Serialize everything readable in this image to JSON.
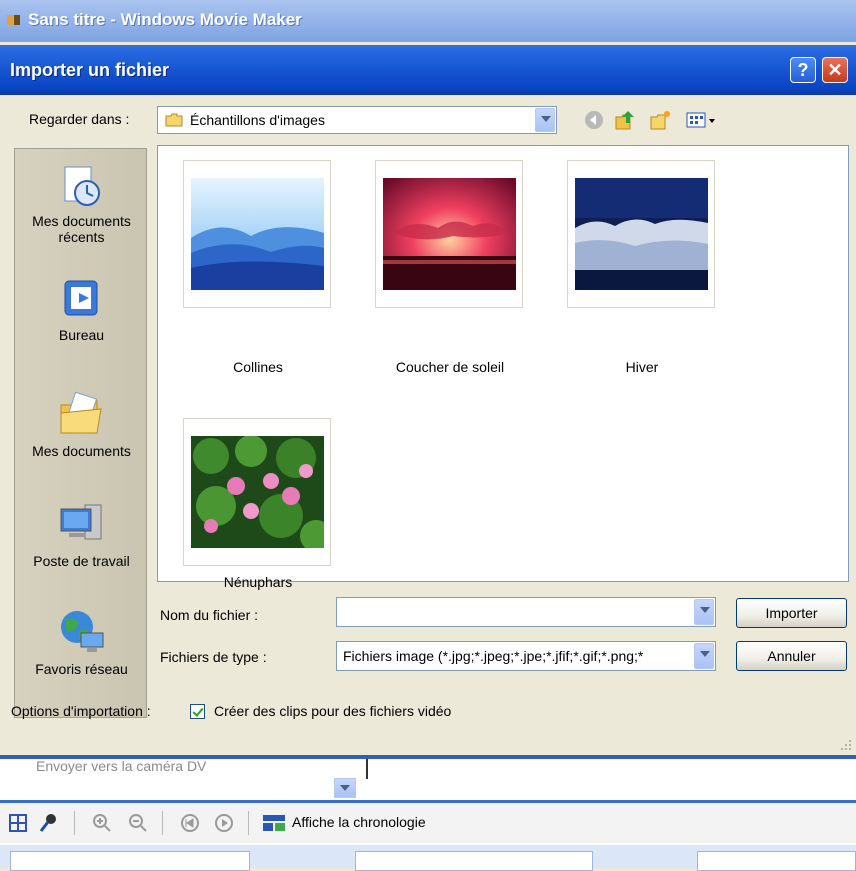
{
  "app": {
    "title": "Sans titre - Windows Movie Maker"
  },
  "dialog": {
    "title": "Importer un fichier",
    "help_glyph": "?",
    "close_glyph": "✕",
    "look_in": {
      "label": "Regarder dans :",
      "value": "Échantillons d'images"
    },
    "places": [
      {
        "label_line1": "Mes documents",
        "label_line2": "récents",
        "icon": "recent-documents-icon"
      },
      {
        "label_line1": "Bureau",
        "label_line2": "",
        "icon": "desktop-icon"
      },
      {
        "label_line1": "Mes documents",
        "label_line2": "",
        "icon": "my-documents-icon"
      },
      {
        "label_line1": "Poste de travail",
        "label_line2": "",
        "icon": "my-computer-icon"
      },
      {
        "label_line1": "Favoris réseau",
        "label_line2": "",
        "icon": "network-places-icon"
      }
    ],
    "files": [
      {
        "name": "Collines"
      },
      {
        "name": "Coucher de soleil"
      },
      {
        "name": "Hiver"
      },
      {
        "name": "Nénuphars"
      }
    ],
    "filename": {
      "label": "Nom du fichier :",
      "value": ""
    },
    "filetype": {
      "label": "Fichiers de type :",
      "value": "Fichiers image (*.jpg;*.jpeg;*.jpe;*.jfif;*.gif;*.png;*"
    },
    "import_button": "Importer",
    "cancel_button": "Annuler",
    "options": {
      "label": "Options d'importation :",
      "checkbox_label": "Créer des clips pour des fichiers vidéo",
      "checked": true
    }
  },
  "movie_maker": {
    "task_text": "Envoyer vers la caméra DV",
    "timeline_toggle": "Affiche la chronologie"
  },
  "colors": {
    "title_blue": "#0a44c4",
    "accent_blue": "#2f5fbd",
    "close_red": "#c7381d"
  }
}
